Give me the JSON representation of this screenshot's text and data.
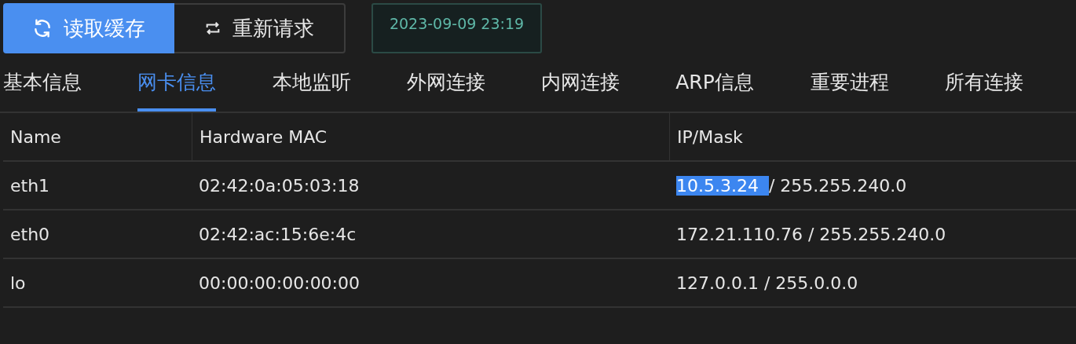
{
  "toolbar": {
    "buttons": [
      {
        "label": "读取缓存",
        "kind": "refresh",
        "selected": true
      },
      {
        "label": "重新请求",
        "kind": "repeat",
        "selected": false
      }
    ],
    "timestamp": "2023-09-09 23:19"
  },
  "tabs": [
    {
      "label": "基本信息",
      "selected": false
    },
    {
      "label": "网卡信息",
      "selected": true
    },
    {
      "label": "本地监听",
      "selected": false
    },
    {
      "label": "外网连接",
      "selected": false
    },
    {
      "label": "内网连接",
      "selected": false
    },
    {
      "label": "ARP信息",
      "selected": false
    },
    {
      "label": "重要进程",
      "selected": false
    },
    {
      "label": "所有连接",
      "selected": false
    }
  ],
  "table": {
    "columns": [
      "Name",
      "Hardware MAC",
      "IP/Mask"
    ],
    "rows": [
      {
        "name": "eth1",
        "mac": "02:42:0a:05:03:18",
        "ip": "10.5.3.24",
        "mask_part": "/ 255.255.240.0",
        "ip_selected": true
      },
      {
        "name": "eth0",
        "mac": "02:42:ac:15:6e:4c",
        "ip": "172.21.110.76",
        "mask_part": "/ 255.255.240.0",
        "ip_selected": false
      },
      {
        "name": "lo",
        "mac": "00:00:00:00:00:00",
        "ip": "127.0.0.1",
        "mask_part": "/ 255.0.0.0",
        "ip_selected": false
      }
    ]
  }
}
